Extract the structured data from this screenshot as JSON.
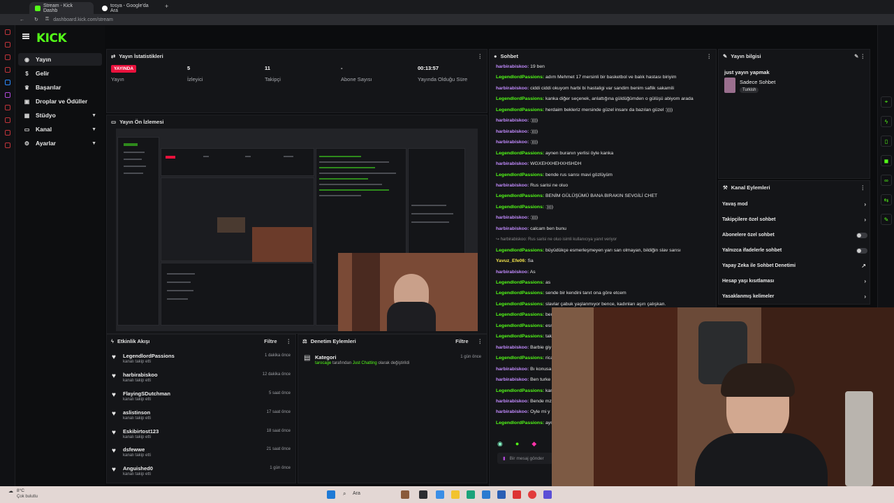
{
  "browser": {
    "tabs": [
      {
        "label": "Stream - Kick Dashb"
      },
      {
        "label": "tosya - Google'da Ara"
      }
    ],
    "url": "dashboard.kick.com/stream"
  },
  "sidebar": {
    "logo": "KICK",
    "items": [
      {
        "label": "Yayın",
        "icon": "broadcast-icon"
      },
      {
        "label": "Gelir",
        "icon": "dollar-icon"
      },
      {
        "label": "Başarılar",
        "icon": "trophy-icon"
      },
      {
        "label": "Droplar ve Ödüller",
        "icon": "gift-icon"
      },
      {
        "label": "Stüdyo",
        "icon": "studio-icon"
      },
      {
        "label": "Kanal",
        "icon": "tv-icon"
      },
      {
        "label": "Ayarlar",
        "icon": "gear-icon"
      }
    ]
  },
  "stats": {
    "title": "Yayın İstatistikleri",
    "live_badge": "YAYINDA",
    "items": [
      {
        "value": "",
        "label": "Yayın"
      },
      {
        "value": "5",
        "label": "İzleyici"
      },
      {
        "value": "11",
        "label": "Takipçi"
      },
      {
        "value": "-",
        "label": "Abone Sayısı"
      },
      {
        "value": "00:13:57",
        "label": "Yayında Olduğu Süre"
      }
    ]
  },
  "preview": {
    "title": "Yayın Ön İzlemesi"
  },
  "activity": {
    "title": "Etkinlik Akışı",
    "filter": "Filtre",
    "events": [
      {
        "name": "LegendlordPassions",
        "sub": "kanalı takip etti",
        "time": "1 dakika önce"
      },
      {
        "name": "harbirabiskoo",
        "sub": "kanalı takip etti",
        "time": "12 dakika önce"
      },
      {
        "name": "FlayingSDutchman",
        "sub": "kanalı takip etti",
        "time": "5 saat önce"
      },
      {
        "name": "aslistinson",
        "sub": "kanalı takip etti",
        "time": "17 saat önce"
      },
      {
        "name": "Eskibirtost123",
        "sub": "kanalı takip etti",
        "time": "18 saat önce"
      },
      {
        "name": "dsfewwe",
        "sub": "kanalı takip etti",
        "time": "21 saat önce"
      },
      {
        "name": "Anguished0",
        "sub": "kanalı takip etti",
        "time": "1 gün önce"
      }
    ]
  },
  "moderation": {
    "title": "Denetim Eylemleri",
    "filter": "Filtre",
    "entry": {
      "heading": "Kategori",
      "user": "tarocage",
      "mid": "tarafından",
      "category": "Just Chatting",
      "tail": "olarak değiştirildi",
      "time": "1 gün önce"
    }
  },
  "chat": {
    "title": "Sohbet",
    "messages": [
      {
        "user": "harbirabiskoo:",
        "text": "19 ben"
      },
      {
        "user": "LegendlordPassions:",
        "text": "adım Mehmet 17 mersinli bir basketbol ve balık hastası biriyim"
      },
      {
        "user": "harbirabiskoo:",
        "text": "ciddi ciddi okuyom harbi bi hastaligi var sandim benim saflik sakamili"
      },
      {
        "user": "LegendlordPassions:",
        "text": "kanka diğer seçenek, anlattığına güldüğümden o gülüşü abiyom arada"
      },
      {
        "user": "LegendlordPassions:",
        "text": "herdaim bekleriz mersinde güzel insanı da bazılan güzel :))))"
      },
      {
        "user": "harbirabiskoo:",
        "text": ":))))"
      },
      {
        "user": "harbirabiskoo:",
        "text": ":))))"
      },
      {
        "user": "harbirabiskoo:",
        "text": ":))))"
      },
      {
        "user": "LegendlordPassions:",
        "text": "aynen buranın yerlisi öyle kanka"
      },
      {
        "user": "harbirabiskoo:",
        "text": "WGXEHXHEHXHSHDH"
      },
      {
        "user": "LegendlordPassions:",
        "text": "bende rus sarısı mavi gözlüyüm"
      },
      {
        "user": "harbirabiskoo:",
        "text": "Rus sarisi ne oluo"
      },
      {
        "user": "LegendlordPassions:",
        "text": "BENİM GÜLÜŞÜMÜ BANA BIRAKIN SEVGİLİ CHET"
      },
      {
        "user": "LegendlordPassions:",
        "text": ":))))"
      },
      {
        "user": "harbirabiskoo:",
        "text": ":))))"
      },
      {
        "user": "harbirabiskoo:",
        "text": "calcam ben bunu"
      },
      {
        "user": "",
        "text": "↪ harbirabiskoo: Rus sarisi ne oluo isimli kullanıcıya yanıt veriyor"
      },
      {
        "user": "LegendlordPassions:",
        "text": "büyüdükçe esmerleşmeyen yarı san olmayan, bildiğin slav sarısı"
      },
      {
        "user": "Yavuz_Efe06:",
        "text": "Sa"
      },
      {
        "user": "harbirabiskoo:",
        "text": "As"
      },
      {
        "user": "LegendlordPassions:",
        "text": "as"
      },
      {
        "user": "LegendlordPassions:",
        "text": "sende bir kendini tanıt ona göre etcem"
      },
      {
        "user": "LegendlordPassions:",
        "text": "slavlar çabuk yaşlanmıyor bence, kadınları aşırı çalışkan."
      },
      {
        "user": "LegendlordPassions:",
        "text": "ben"
      },
      {
        "user": "LegendlordPassions:",
        "text": "esn"
      },
      {
        "user": "LegendlordPassions:",
        "text": "tak"
      },
      {
        "user": "harbirabiskoo:",
        "text": "Barbie giy"
      },
      {
        "user": "LegendlordPassions:",
        "text": "rica"
      },
      {
        "user": "harbirabiskoo:",
        "text": "Bı konusa"
      },
      {
        "user": "harbirabiskoo:",
        "text": "Ben turke"
      },
      {
        "user": "LegendlordPassions:",
        "text": "kan"
      },
      {
        "user": "harbirabiskoo:",
        "text": "Bende mz"
      },
      {
        "user": "harbirabiskoo:",
        "text": "Oyle mi y"
      },
      {
        "user": "LegendlordPassions:",
        "text": "ayn"
      }
    ],
    "input_placeholder": "Bir mesaj gönder"
  },
  "stream_info": {
    "title": "Yayın bilgisi",
    "stream_title": "just yayın yapmak",
    "category": "Sadece Sohbet",
    "tag": "Turkish"
  },
  "channel_actions": {
    "title": "Kanal Eylemleri",
    "items": [
      {
        "label": "Yavaş mod",
        "control": "arrow"
      },
      {
        "label": "Takipçilere özel sohbet",
        "control": "arrow"
      },
      {
        "label": "Abonelere özel sohbet",
        "control": "toggle"
      },
      {
        "label": "Yalnızca ifadelerle sohbet",
        "control": "toggle"
      },
      {
        "label": "Yapay Zeka ile Sohbet Denetimi",
        "control": "external"
      },
      {
        "label": "Hesap yaşı kısıtlaması",
        "control": "arrow"
      },
      {
        "label": "Yasaklanmış kelimeler",
        "control": "arrow"
      }
    ]
  },
  "taskbar": {
    "weather_temp": "8°C",
    "weather_text": "Çok bulutlu",
    "search": "Ara"
  },
  "colors": {
    "accent": "#53fc18",
    "live": "#e9113c",
    "bg": "#0b0c0e",
    "panel": "#141518"
  }
}
